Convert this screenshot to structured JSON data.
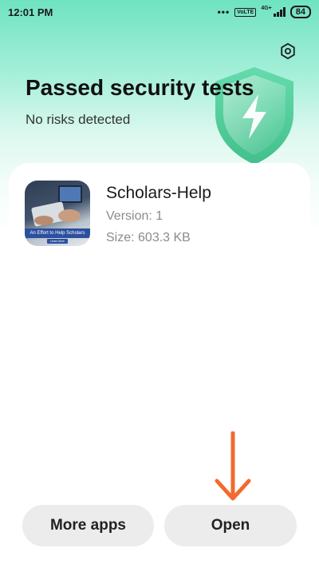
{
  "status_bar": {
    "time": "12:01 PM",
    "dots": "•••",
    "volte_label": "VoLTE",
    "network_label": "4G+",
    "battery": "84"
  },
  "header": {
    "title": "Passed security tests",
    "subtitle": "No risks detected",
    "settings_icon": "gear-icon",
    "shield_icon": "shield-lightning-icon"
  },
  "app": {
    "name": "Scholars-Help",
    "version": "Version: 1",
    "size": "Size: 603.3 KB",
    "icon_banner_text": "An Effort to Help Scholars",
    "icon_button_text": "Learn More"
  },
  "buttons": {
    "more_apps": "More apps",
    "open": "Open"
  },
  "colors": {
    "accent_green": "#6fe3c0",
    "arrow_orange": "#f26a2e",
    "button_bg": "#ececec"
  }
}
